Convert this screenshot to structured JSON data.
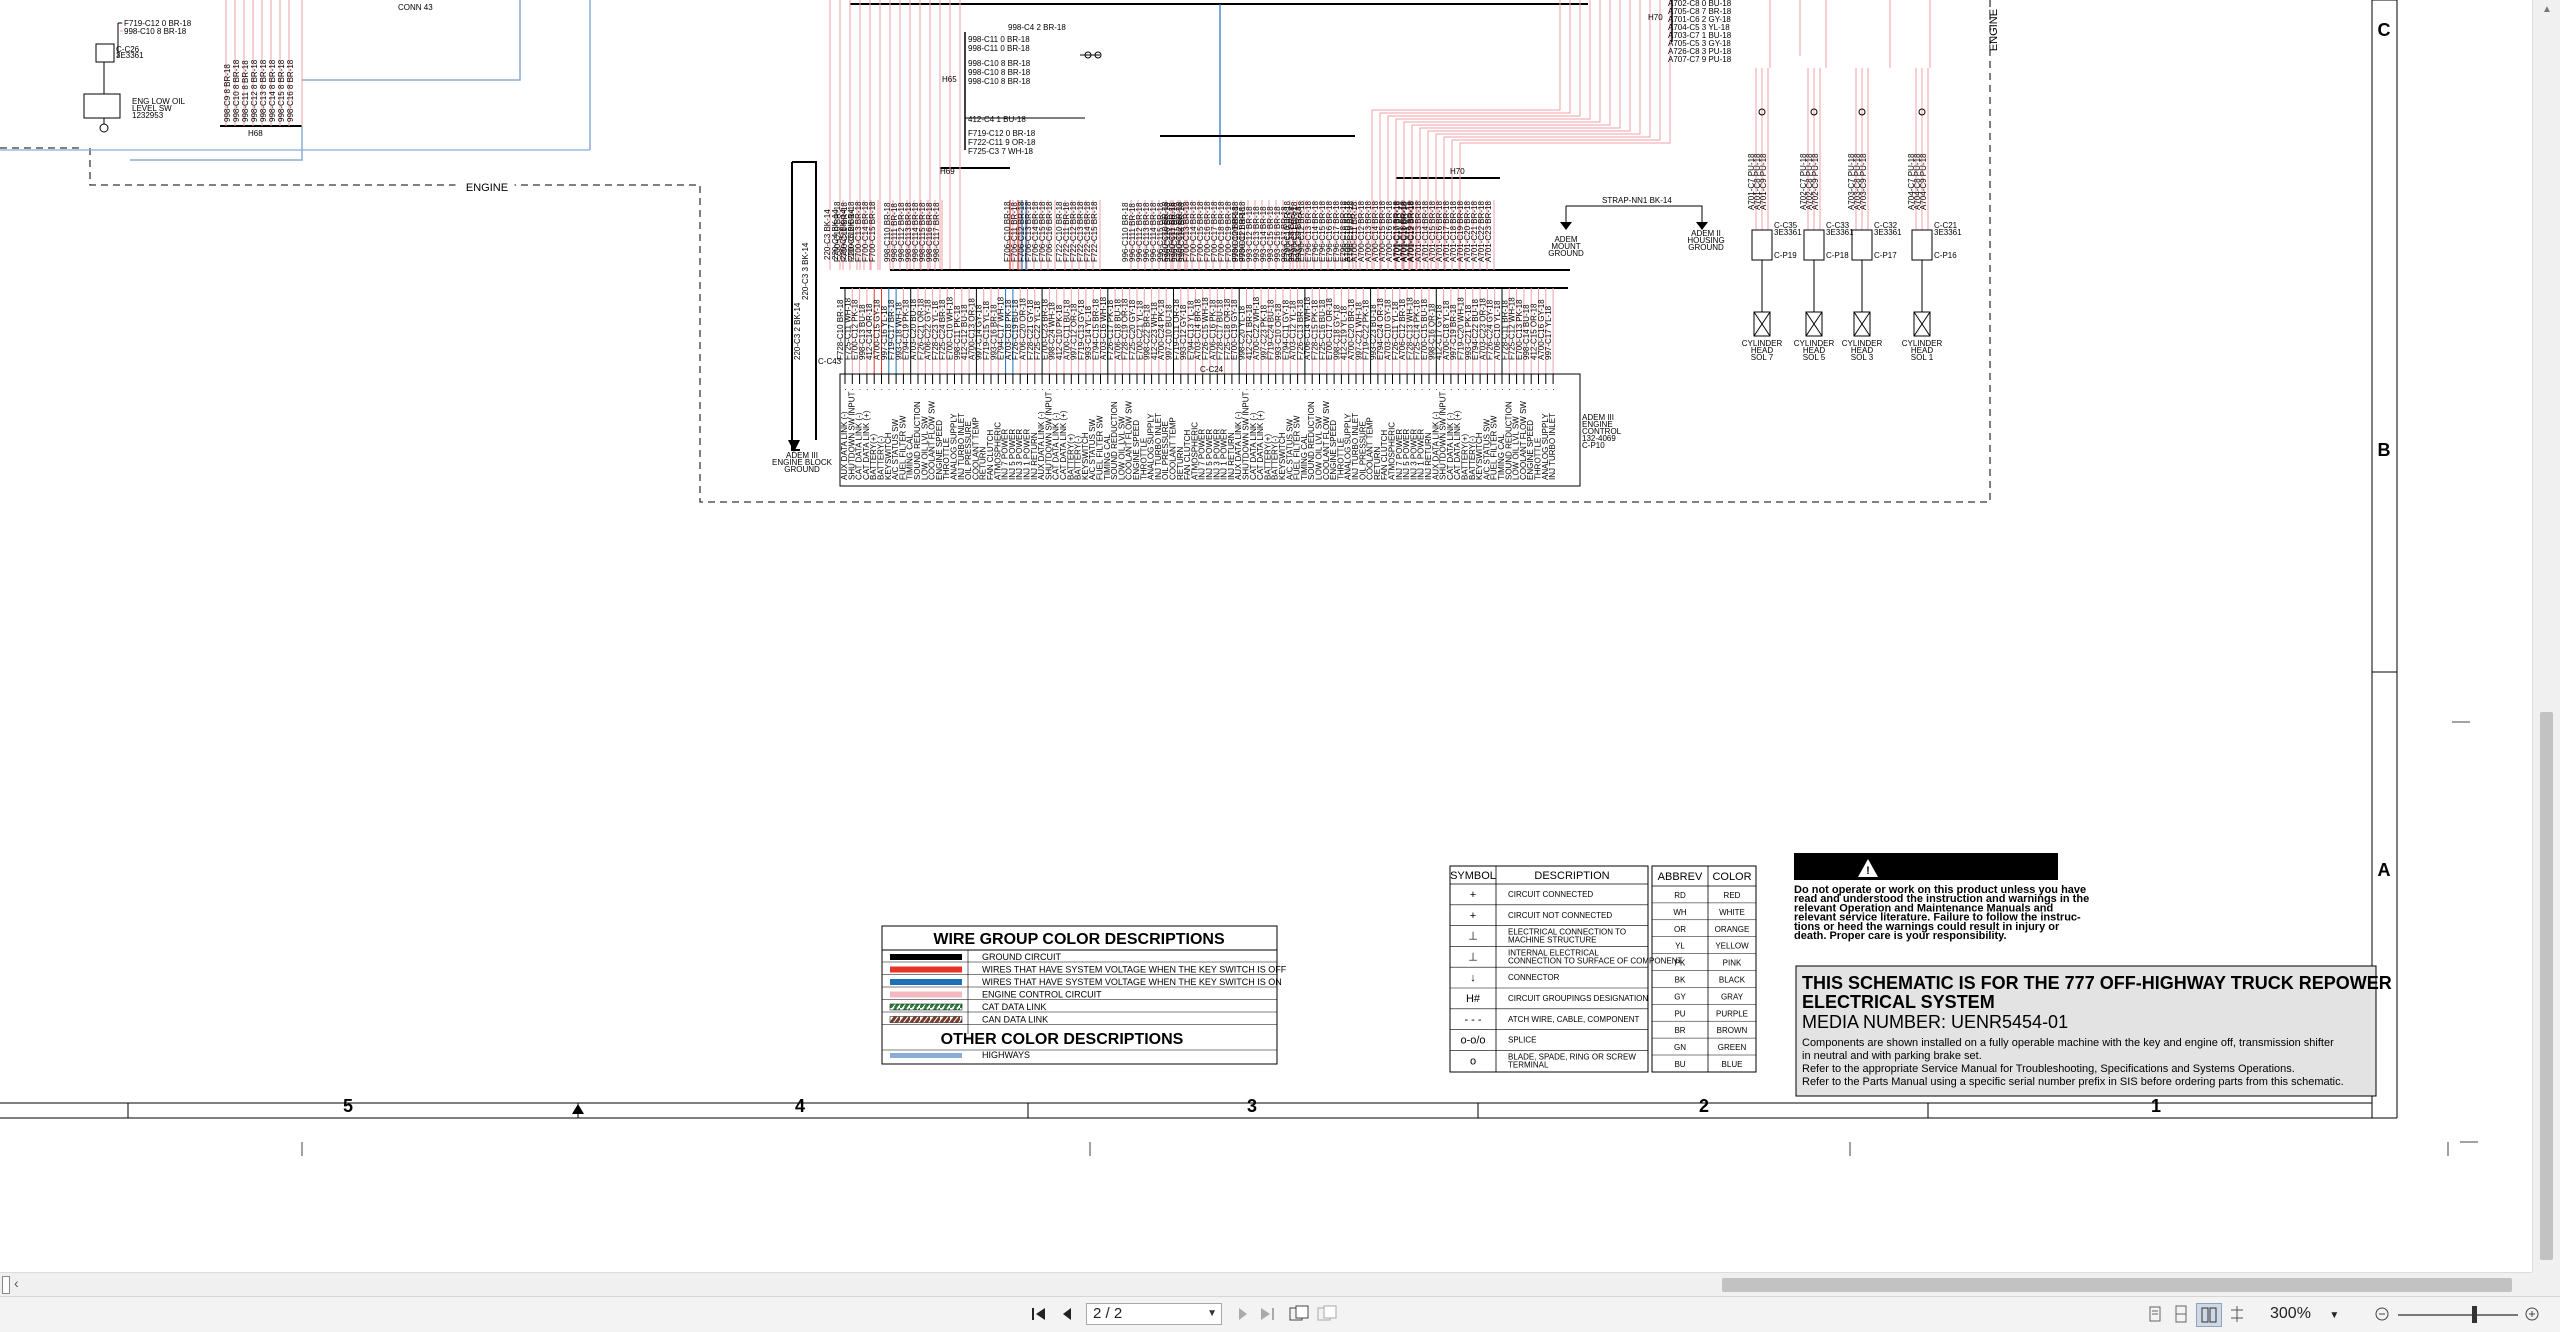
{
  "schematic": {
    "zone_letters": [
      "C",
      "B",
      "A"
    ],
    "column_numbers": [
      "5",
      "4",
      "3",
      "2",
      "1"
    ],
    "engine_label": "ENGINE",
    "conn_label": "CONN 43",
    "top_left_wires": [
      "F719-C12 0  BR-18",
      "998-C10 8  BR-18"
    ],
    "sensor_ids": [
      "C-C26",
      "3E3361"
    ],
    "engine_oil_switch": [
      "ENG LOW OIL",
      "LEVEL SW",
      "1232953"
    ],
    "bundle_h68": "H68",
    "bundle_h69": "H69",
    "bundle_h70": "H70",
    "bundle_h65": "H65",
    "mid_wires": [
      "998-C11 0  BR-18",
      "998-C11 0  BR-18",
      "998-C10 8  BR-18",
      "998-C10 8  BR-18",
      "998-C10 8  BR-18"
    ],
    "mid_wire_top": "998-C4 2  BR-18",
    "mid_wire_bu": "412-C4 1  BU-18",
    "mid_wires_lower": [
      "F719-C12 0  BR-18",
      "F722-C11 9  OR-18",
      "F725-C3 7  WH-18"
    ],
    "right_top_wires": [
      "A702-C8 0  BU-18",
      "A705-C8 7  BR-18",
      "A701-C6 2  GY-18",
      "A704-C5 3  YL-18",
      "A703-C7 1  BU-18",
      "A705-C5 3  GY-18",
      "A726-C8 3  PU-18",
      "A707-C7 9  PU-18"
    ],
    "strap_label": "STRAP-NN1  BK-14",
    "ground_labels": [
      [
        "ADEM",
        "MOUNT",
        "GROUND"
      ],
      [
        "ADEM II",
        "HOUSING",
        "GROUND"
      ],
      [
        "ADEM III",
        "ENGINE BLOCK",
        "GROUND"
      ]
    ],
    "connectors": [
      {
        "id": "C-C35",
        "part": "3E3361",
        "pin": "C-P19"
      },
      {
        "id": "C-C33",
        "part": "3E3361",
        "pin": "C-P18"
      },
      {
        "id": "C-C32",
        "part": "3E3361",
        "pin": "C-P17"
      },
      {
        "id": "C-C21",
        "part": "3E3361",
        "pin": "C-P16"
      }
    ],
    "cylinder_labels": [
      [
        "CYLINDER",
        "HEAD",
        "SOL 7"
      ],
      [
        "CYLINDER",
        "HEAD",
        "SOL 5"
      ],
      [
        "CYLINDER",
        "HEAD",
        "SOL 3"
      ],
      [
        "CYLINDER",
        "HEAD",
        "SOL 1"
      ]
    ],
    "ecm_label": [
      "ADEM III",
      "ENGINE",
      "CONTROL",
      "132-4069",
      "C-P10"
    ],
    "ecm_connectors": [
      "C-C43",
      "C-C24"
    ],
    "ecm_pin_labels": [
      "AUX DATA LINK (-)",
      "SHUTDOWN SW INPUT",
      "CAT DATA LINK (-)",
      "CAT DATA LINK (+)",
      "BATTERY(+)",
      "BATTERY(-)",
      "KEYSWITCH",
      "A/C STATUS SW",
      "FUEL FILTER SW",
      "TIMING CAL",
      "SOUND REDUCTION",
      "LOW OIL LVL SW",
      "COOLANT FLOW SW",
      "ENGINE SPEED",
      "THROTTLE",
      "ANALOG SUPPLY",
      "INJ TURBO INLET",
      "OIL PRESSURE",
      "COOLANT TEMP",
      "RETURN",
      "FAN CLUTCH",
      "ATMOSPHERIC",
      "INJ 7 POWER",
      "INJ 5 POWER",
      "INJ 3 POWER",
      "INJ 1 POWER",
      "INJ RETURN"
    ]
  },
  "wire_legend": {
    "title": "WIRE GROUP COLOR DESCRIPTIONS",
    "items": [
      {
        "color": "#000000",
        "pattern": "solid",
        "label": "GROUND CIRCUIT"
      },
      {
        "color": "#e8332a",
        "pattern": "solid",
        "label": "WIRES THAT HAVE SYSTEM VOLTAGE WHEN THE KEY SWITCH IS OFF"
      },
      {
        "color": "#1f6fb8",
        "pattern": "solid",
        "label": "WIRES THAT HAVE SYSTEM VOLTAGE WHEN THE KEY SWITCH IS ON"
      },
      {
        "color": "#f4b8c0",
        "pattern": "solid",
        "label": "ENGINE CONTROL CIRCUIT"
      },
      {
        "color": "#2a7a3a",
        "pattern": "hatched",
        "label": "CAT DATA LINK"
      },
      {
        "color": "#7a3a2a",
        "pattern": "hatched",
        "label": "CAN DATA LINK"
      }
    ],
    "other_title": "OTHER COLOR DESCRIPTIONS",
    "other_items": [
      {
        "color": "#8aacd6",
        "label": "HIGHWAYS"
      }
    ]
  },
  "symbol_legend": {
    "headers": [
      "SYMBOL",
      "DESCRIPTION"
    ],
    "rows": [
      {
        "symbol": "+",
        "description": "CIRCUIT CONNECTED"
      },
      {
        "symbol": "+",
        "description": "CIRCUIT NOT CONNECTED"
      },
      {
        "symbol": "⊥",
        "description": "ELECTRICAL CONNECTION TO MACHINE STRUCTURE"
      },
      {
        "symbol": "⊥",
        "description": "INTERNAL ELECTRICAL CONNECTION TO SURFACE OF COMPONENT"
      },
      {
        "symbol": "↓",
        "description": "CONNECTOR"
      },
      {
        "symbol": "H#",
        "description": "CIRCUIT GROUPINGS DESIGNATION"
      },
      {
        "symbol": "- - -",
        "description": "ATCH WIRE, CABLE, COMPONENT"
      },
      {
        "symbol": "o-o/o",
        "description": "SPLICE"
      },
      {
        "symbol": "o",
        "description": "BLADE, SPADE, RING OR SCREW TERMINAL"
      }
    ]
  },
  "abbrev_table": {
    "headers": [
      "ABBREV",
      "COLOR"
    ],
    "rows": [
      [
        "RD",
        "RED"
      ],
      [
        "WH",
        "WHITE"
      ],
      [
        "OR",
        "ORANGE"
      ],
      [
        "YL",
        "YELLOW"
      ],
      [
        "PK",
        "PINK"
      ],
      [
        "BK",
        "BLACK"
      ],
      [
        "GY",
        "GRAY"
      ],
      [
        "PU",
        "PURPLE"
      ],
      [
        "BR",
        "BROWN"
      ],
      [
        "GN",
        "GREEN"
      ],
      [
        "BU",
        "BLUE"
      ]
    ]
  },
  "warning": {
    "title": "WARNING",
    "text": [
      "Do not operate or work on this product unless you have",
      "read and understood the instruction and warnings in the",
      "relevant Operation and Maintenance Manuals and",
      "relevant service literature. Failure to follow the instruc-",
      "tions or heed the warnings could result in injury or",
      "death. Proper care is your responsibility."
    ]
  },
  "title_block": {
    "line1": "THIS SCHEMATIC IS FOR THE 777 OFF-HIGHWAY TRUCK REPOWER",
    "line2": "ELECTRICAL SYSTEM",
    "media": "MEDIA NUMBER: UENR5454-01",
    "notes": [
      "Components are shown installed on a fully operable machine with the key and engine off, transmission shifter",
      "in neutral and with parking brake set.",
      "Refer to the appropriate Service Manual for Troubleshooting, Specifications and Systems Operations.",
      "Refer to the Parts Manual using a specific serial number prefix in SIS before ordering parts from this schematic."
    ]
  },
  "toolbar": {
    "page_value": "2 / 2",
    "zoom": "300%",
    "icons": [
      "first-page-icon",
      "prev-page-icon",
      "next-page-icon",
      "last-page-icon",
      "fit-width-icon",
      "fit-page-icon",
      "single-page-icon",
      "continuous-icon",
      "two-page-icon",
      "scroll-mode-icon",
      "zoom-out-icon",
      "zoom-in-icon"
    ]
  }
}
